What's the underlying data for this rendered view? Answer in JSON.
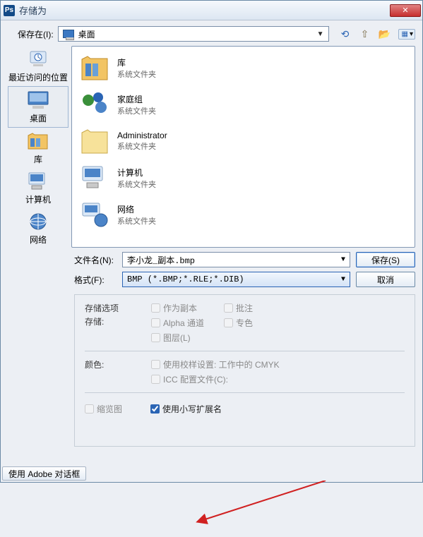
{
  "titlebar": {
    "app_icon_text": "Ps",
    "title": "存储为",
    "close": "✕"
  },
  "look_in": {
    "label": "保存在(I):",
    "selected": "桌面"
  },
  "tool_tips": {
    "back": "back",
    "up": "up",
    "new": "new-folder",
    "view": "view"
  },
  "sidebar": {
    "items": [
      {
        "label": "最近访问的位置"
      },
      {
        "label": "桌面"
      },
      {
        "label": "库"
      },
      {
        "label": "计算机"
      },
      {
        "label": "网络"
      }
    ]
  },
  "filelist": {
    "items": [
      {
        "title": "库",
        "sub": "系统文件夹"
      },
      {
        "title": "家庭组",
        "sub": "系统文件夹"
      },
      {
        "title": "Administrator",
        "sub": "系统文件夹"
      },
      {
        "title": "计算机",
        "sub": "系统文件夹"
      },
      {
        "title": "网络",
        "sub": "系统文件夹"
      }
    ]
  },
  "fields": {
    "name_label": "文件名(N):",
    "name_value": "李小龙_副本.bmp",
    "format_label": "格式(F):",
    "format_value": "BMP (*.BMP;*.RLE;*.DIB)",
    "save_btn": "保存(S)",
    "cancel_btn": "取消"
  },
  "options": {
    "group_label": "存储选项",
    "store_label": "存储:",
    "color_label": "颜色:",
    "as_copy": "作为副本",
    "notes": "批注",
    "alpha": "Alpha 通道",
    "spot": "专色",
    "layers": "图层(L)",
    "use_proof": "使用校样设置: 工作中的 CMYK",
    "icc": "ICC 配置文件(C):",
    "thumb": "缩览图",
    "lower": "使用小写扩展名"
  },
  "footer": {
    "adobe_btn": "使用 Adobe 对话框"
  }
}
